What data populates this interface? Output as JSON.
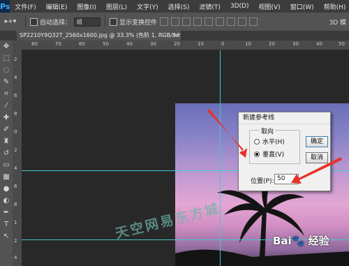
{
  "app": {
    "logo": "Ps"
  },
  "menu": [
    "文件(F)",
    "编辑(E)",
    "图像(I)",
    "图层(L)",
    "文字(Y)",
    "选择(S)",
    "滤镜(T)",
    "3D(D)",
    "视图(V)",
    "窗口(W)",
    "帮助(H)"
  ],
  "options": {
    "auto_select_label": "自动选择：",
    "auto_select_value": "组",
    "transform_controls_label": "显示变换控件",
    "mode_3d": "3D 模"
  },
  "document": {
    "tab_title": "SP2210Y9Q32T_2560x1600.jpg @ 33.3% (色阶 1, RGB/8#) *",
    "close": "×"
  },
  "rulers": {
    "top": [
      "80",
      "70",
      "60",
      "50",
      "40",
      "30",
      "20",
      "10",
      "0",
      "10",
      "20",
      "30",
      "40",
      "50"
    ],
    "left": [
      "2",
      "4",
      "6",
      "8",
      "0",
      "2",
      "4",
      "6",
      "8",
      "1",
      "2",
      "4"
    ]
  },
  "dialog": {
    "title": "新建参考线",
    "orientation_legend": "取向",
    "horizontal_label": "水平(H)",
    "vertical_label": "垂直(V)",
    "selected": "vertical",
    "ok_label": "确定",
    "cancel_label": "取消",
    "position_label": "位置(P):",
    "position_value": "50"
  },
  "overlay": {
    "watermark": "天空网易东方城",
    "baidu": "Bai🐾 经验"
  },
  "colors": {
    "guide": "#3fc8d0",
    "arrow": "#e8322a",
    "accent": "#3fa9f5"
  }
}
